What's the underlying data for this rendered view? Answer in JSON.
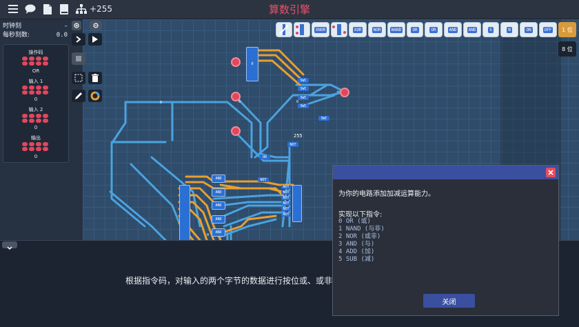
{
  "topbar": {
    "title": "算数引擎",
    "count": "+255",
    "icons": [
      "menu-icon",
      "chat-icon",
      "document-icon",
      "book-icon",
      "hierarchy-icon"
    ]
  },
  "clock_panel": {
    "tick_label": "时钟刻",
    "tick_value": "–",
    "tps_label": "每秒刻数:",
    "tps_value": "0.0"
  },
  "values_panel": {
    "opcode_label": "操作码",
    "opcode_value": "OR",
    "input1_label": "输入 1",
    "input1_value": "0",
    "input2_label": "输入 2",
    "input2_value": "0",
    "output_label": "输出",
    "output_value": "0"
  },
  "palette": {
    "items": [
      "",
      "",
      "XNOR",
      "",
      "XOR",
      "NOR",
      "NAND",
      "OR",
      "OR",
      "AND",
      "AND",
      "S",
      "N",
      "ON",
      "OFF"
    ]
  },
  "side_buttons": {
    "top": "1 位",
    "second": "8 位"
  },
  "circuit": {
    "labels": {
      "swc": "SWC",
      "or": "OR",
      "not": "NOT",
      "and": "AND",
      "v255": "255",
      "zero": "0"
    }
  },
  "bottom": {
    "description": "根据指令码，对输入的两个字节的数据进行按位或、或非"
  },
  "dialog": {
    "intro": "为你的电路添加加减运算能力。",
    "lead": "实现以下指令:",
    "instructions": [
      "0 OR (或)",
      "1 NAND (与非)",
      "2 NOR (或非)",
      "3 AND (与)",
      "4 ADD (加)",
      "5 SUB (减)"
    ],
    "close_button": "关闭"
  },
  "colors": {
    "accent_red": "#e5526b",
    "wire_blue": "#4aa3e0",
    "wire_orange": "#e8a030",
    "dialog_header": "#3b4fa0"
  }
}
